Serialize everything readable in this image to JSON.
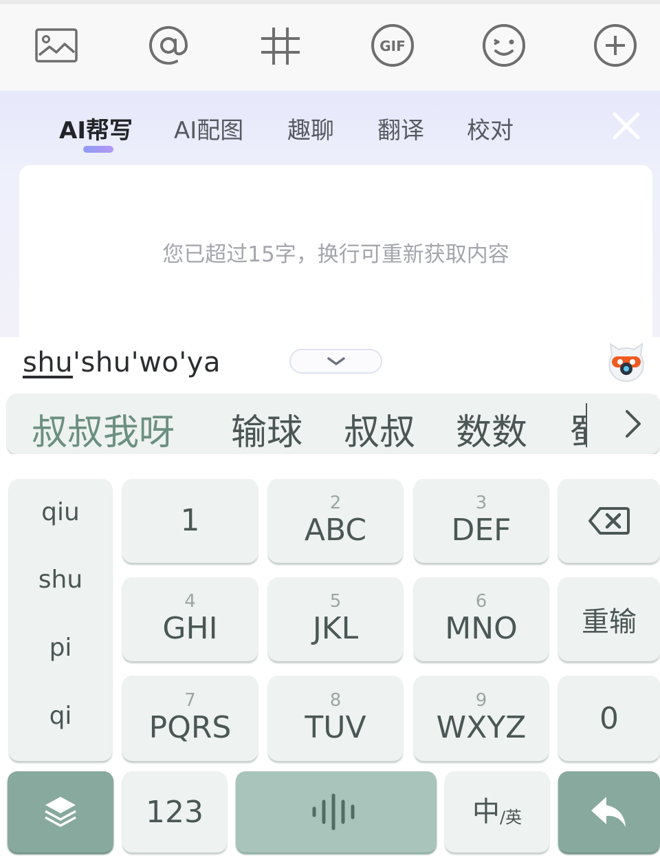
{
  "toolbar": {
    "icons": [
      "image-icon",
      "at-icon",
      "hashtag-icon",
      "gif-icon",
      "emoji-icon",
      "plus-icon"
    ],
    "gif_label": "GIF"
  },
  "ai_panel": {
    "tabs": [
      {
        "label": "AI帮写",
        "active": true
      },
      {
        "label": "AI配图",
        "active": false
      },
      {
        "label": "趣聊",
        "active": false
      },
      {
        "label": "翻译",
        "active": false
      },
      {
        "label": "校对",
        "active": false
      }
    ],
    "hint": "您已超过15字，换行可重新获取内容"
  },
  "composition": {
    "underlined": "shu",
    "rest": "'shu'wo'ya"
  },
  "candidates": {
    "items": [
      "叔叔我呀",
      "输球",
      "叔叔",
      "数数"
    ],
    "partial": "蜀"
  },
  "keyboard": {
    "pinyin_options": [
      "qiu",
      "shu",
      "pi",
      "qi"
    ],
    "keys": [
      {
        "num": "",
        "letters": "1"
      },
      {
        "num": "2",
        "letters": "ABC"
      },
      {
        "num": "3",
        "letters": "DEF"
      },
      {
        "num": "4",
        "letters": "GHI"
      },
      {
        "num": "5",
        "letters": "JKL"
      },
      {
        "num": "6",
        "letters": "MNO"
      },
      {
        "num": "7",
        "letters": "PQRS"
      },
      {
        "num": "8",
        "letters": "TUV"
      },
      {
        "num": "9",
        "letters": "WXYZ"
      }
    ],
    "reinput": "重输",
    "zero": "0",
    "num_mode": "123",
    "lang_main": "中",
    "lang_sub": "/英"
  },
  "colors": {
    "accent_dark": "#88a99d",
    "accent_mid": "#a9c4bb",
    "key_bg": "#eef2f1",
    "first_candidate": "#6b8f80"
  }
}
